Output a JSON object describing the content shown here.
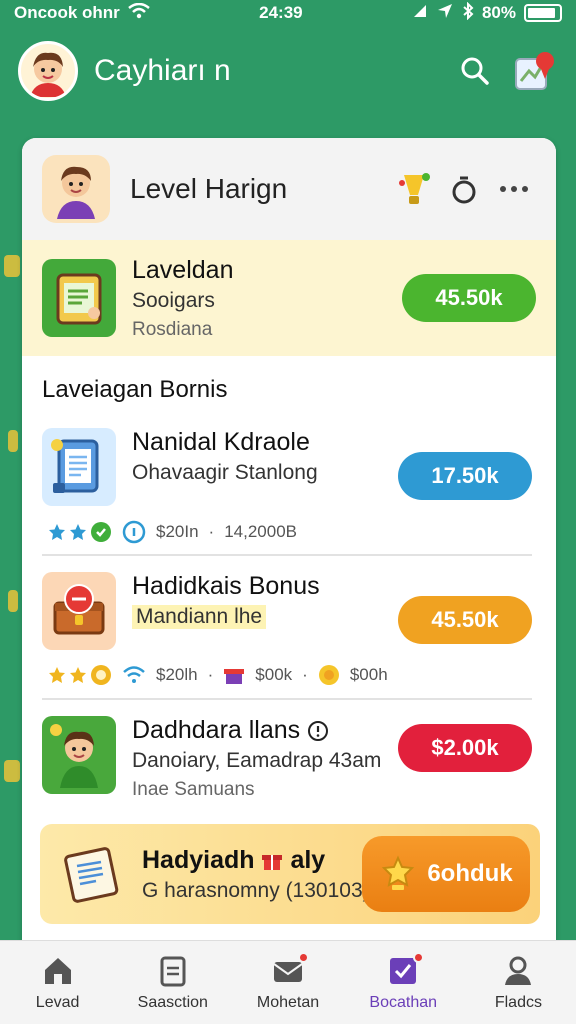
{
  "status_bar": {
    "carrier": "Oncook ohnr",
    "time": "24:39",
    "battery": "80%"
  },
  "app_bar": {
    "title": "Cayhiarı n"
  },
  "card_header": {
    "title": "Level Harign"
  },
  "featured": {
    "title": "Laveldan",
    "subtitle": "Sooigars",
    "caption": "Rosdiana",
    "amount": "45.50k",
    "accent": "#4bb52f"
  },
  "section": {
    "title": "Laveiagan Bornis"
  },
  "rows": [
    {
      "title": "Nanidal Kdraole",
      "subtitle": "Ohavaagir Stanlong",
      "amount": "17.50k",
      "accent": "#2e9ad3",
      "meta": [
        "$20In",
        "14,2000B"
      ]
    },
    {
      "title": "Hadidkais Bonus",
      "subtitle": "Mandiann lhe",
      "amount": "45.50k",
      "accent": "#f0a221",
      "meta": [
        "$20lh",
        "$00k",
        "$00h"
      ]
    },
    {
      "title": "Dadhdara llans",
      "subtitle": "Danoiary, Eamadrap 43am",
      "caption": "Inae Samuans",
      "amount": "$2.00k",
      "accent": "#e2203c"
    }
  ],
  "promo": {
    "title": "Hadyiadh",
    "title_suffix": "aly",
    "subtitle": "G harasnomny (130103)",
    "button_label": "6ohduk"
  },
  "bottom_nav": [
    {
      "label": "Levad"
    },
    {
      "label": "Saasction"
    },
    {
      "label": "Mohetan"
    },
    {
      "label": "Bocathan"
    },
    {
      "label": "Fladcs"
    }
  ]
}
